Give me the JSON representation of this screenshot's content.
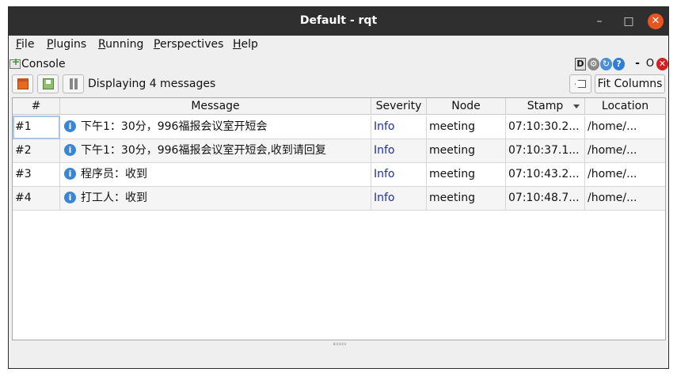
{
  "window": {
    "title": "Default - rqt"
  },
  "window_controls": {
    "minimize": "–",
    "maximize": "□",
    "close": "✕"
  },
  "menu": [
    "File",
    "Plugins",
    "Running",
    "Perspectives",
    "Help"
  ],
  "console": {
    "title": "Console",
    "controls": {
      "d": "D",
      "dash": "-",
      "o": "O",
      "x": "✕",
      "help": "?"
    }
  },
  "toolbar": {
    "status": "Displaying 4 messages",
    "fit_columns": "Fit Columns"
  },
  "icons": {
    "console": "console-icon",
    "open": "folder-open-icon",
    "save": "save-icon",
    "pause": "pause-icon",
    "clear": "clear-icon",
    "info": "info-icon"
  },
  "colors": {
    "titlebar": "#2f2f2f",
    "close": "#e95420",
    "severity_info": "#1f2fa0",
    "info_icon": "#3a86d6"
  },
  "table": {
    "columns": [
      "#",
      "Message",
      "Severity",
      "Node",
      "Stamp",
      "Location"
    ],
    "rows": [
      {
        "num": "#1",
        "message": "下午1：30分，996福报会议室开短会",
        "severity": "Info",
        "node": "meeting",
        "stamp": "07:10:30.2...",
        "location": "/home/..."
      },
      {
        "num": "#2",
        "message": "下午1：30分，996福报会议室开短会,收到请回复",
        "severity": "Info",
        "node": "meeting",
        "stamp": "07:10:37.1...",
        "location": "/home/..."
      },
      {
        "num": "#3",
        "message": "程序员：收到",
        "severity": "Info",
        "node": "meeting",
        "stamp": "07:10:43.2...",
        "location": "/home/..."
      },
      {
        "num": "#4",
        "message": "打工人：收到",
        "severity": "Info",
        "node": "meeting",
        "stamp": "07:10:48.7...",
        "location": "/home/..."
      }
    ]
  }
}
